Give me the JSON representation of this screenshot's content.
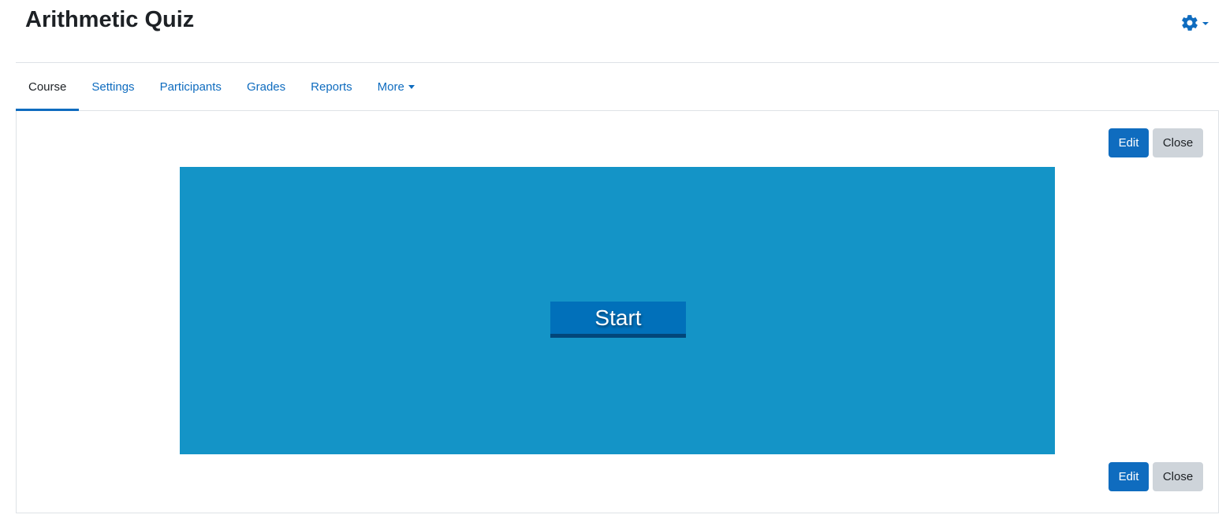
{
  "page": {
    "title": "Arithmetic Quiz"
  },
  "header": {
    "settings_icon": "gear-icon",
    "settings_caret_icon": "caret-down-icon"
  },
  "tabs": [
    {
      "label": "Course",
      "active": true
    },
    {
      "label": "Settings",
      "active": false
    },
    {
      "label": "Participants",
      "active": false
    },
    {
      "label": "Grades",
      "active": false
    },
    {
      "label": "Reports",
      "active": false
    },
    {
      "label": "More",
      "active": false,
      "has_dropdown": true
    }
  ],
  "toolbar_top": {
    "edit_label": "Edit",
    "close_label": "Close"
  },
  "toolbar_bottom": {
    "edit_label": "Edit",
    "close_label": "Close"
  },
  "activity": {
    "start_label": "Start"
  },
  "colors": {
    "accent": "#0f6cbf",
    "stage_background": "#1494c7",
    "start_button": "#0170ba",
    "secondary_button": "#ced4da"
  }
}
